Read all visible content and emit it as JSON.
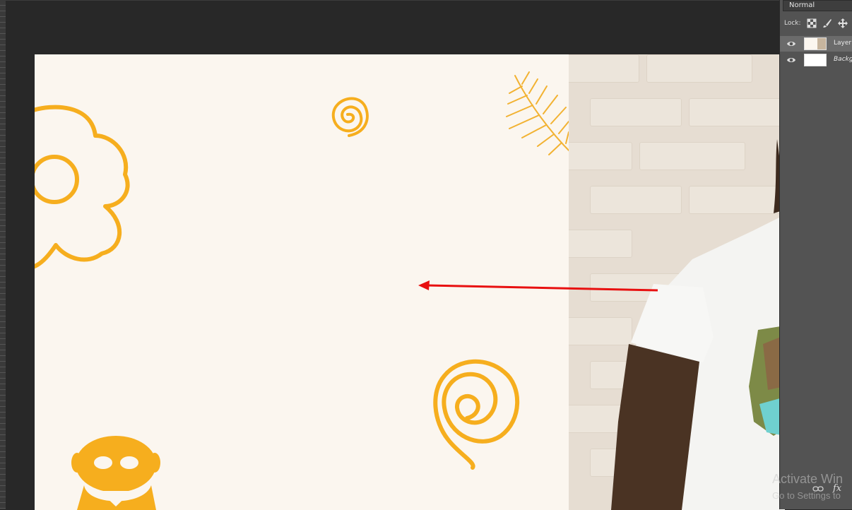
{
  "layers_panel": {
    "blend_mode": "Normal",
    "lock_label": "Lock:",
    "layers": [
      {
        "name": "Layer",
        "visible": true,
        "active": true
      },
      {
        "name": "Backg",
        "visible": true,
        "active": false
      }
    ],
    "footer_icons": [
      "link-icon",
      "fx-icon"
    ]
  },
  "watermark": {
    "line1": "Activate Win",
    "line2": "Go to Settings to"
  },
  "colors": {
    "canvas": "#fbf6ef",
    "motif": "#f6ae1e",
    "arrow": "#e81010",
    "panel": "#535353",
    "workspace": "#282828"
  }
}
